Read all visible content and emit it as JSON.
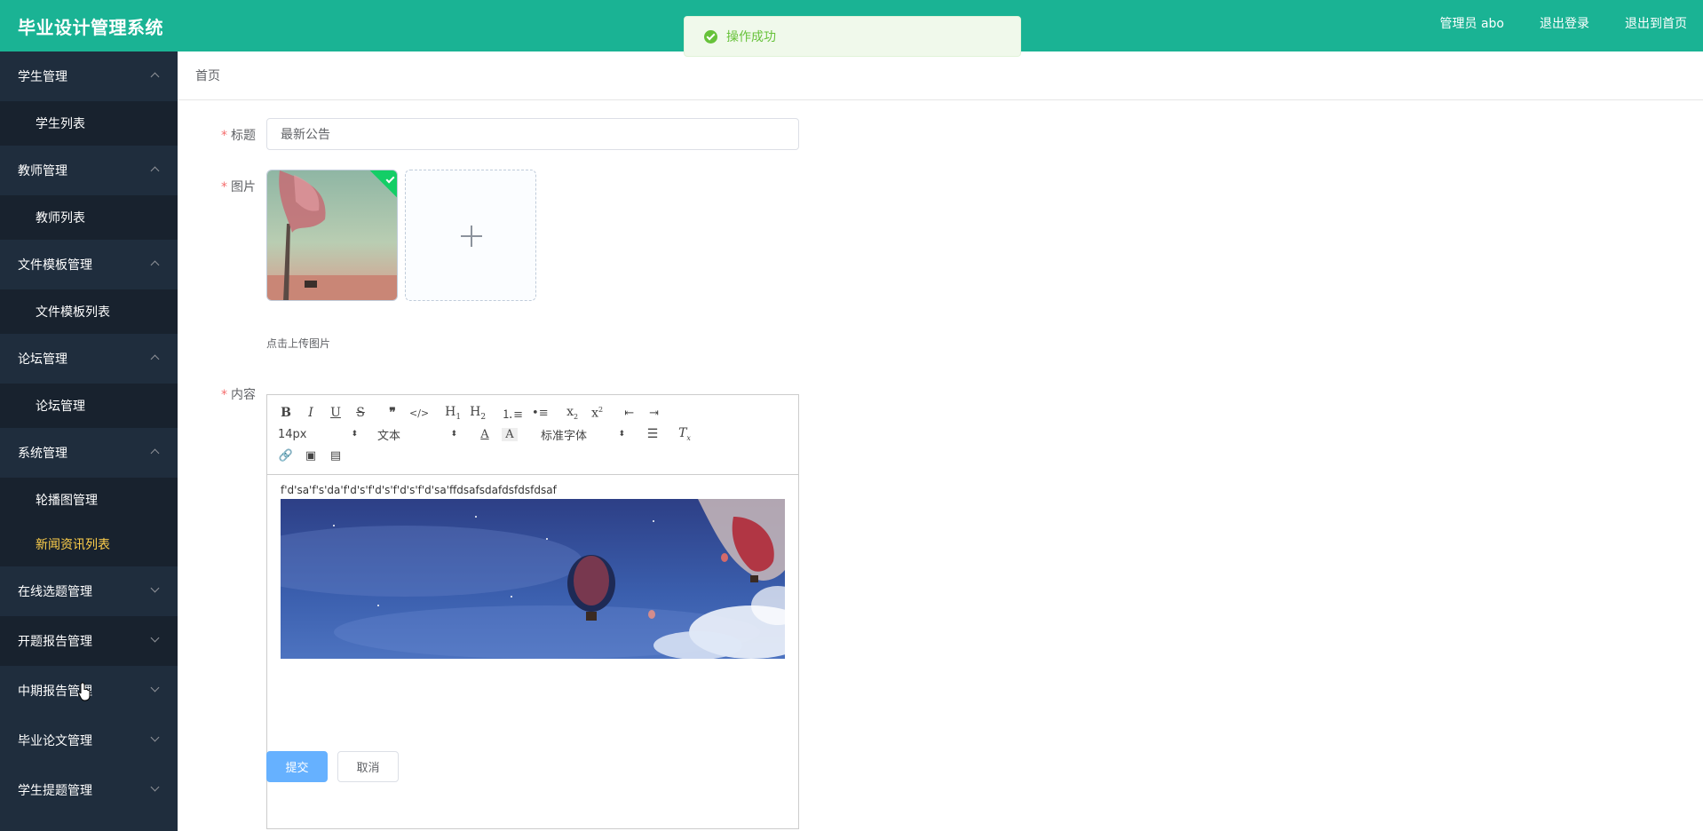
{
  "header": {
    "brand": "毕业设计管理系统",
    "admin_label": "管理员 abo",
    "logout": "退出登录",
    "exit_home": "退出到首页",
    "bg_color": "#1ab394"
  },
  "toast": {
    "message": "操作成功",
    "icon": "success-check-icon"
  },
  "sidebar": {
    "groups": [
      {
        "label": "学生管理",
        "items": [
          "学生列表"
        ]
      },
      {
        "label": "教师管理",
        "items": [
          "教师列表"
        ]
      },
      {
        "label": "文件模板管理",
        "items": [
          "文件模板列表"
        ]
      },
      {
        "label": "论坛管理",
        "items": [
          "论坛管理"
        ]
      },
      {
        "label": "系统管理",
        "items": [
          "轮播图管理",
          "新闻资讯列表"
        ]
      },
      {
        "label": "在线选题管理"
      },
      {
        "label": "开题报告管理"
      },
      {
        "label": "中期报告管理"
      },
      {
        "label": "毕业论文管理"
      },
      {
        "label": "学生提题管理"
      }
    ],
    "active_item": "新闻资讯列表",
    "active_color": "#ffd04b"
  },
  "breadcrumb": {
    "home": "首页"
  },
  "form": {
    "title_label": "标题",
    "title_value": "最新公告",
    "image_label": "图片",
    "upload_tip": "点击上传图片",
    "content_label": "内容",
    "editor": {
      "font_size": "14px",
      "header_select": "文本",
      "font_select": "标准字体",
      "content_text": "f'd'sa'f's'da'f'd's'f'd's'f'd's'f'd'sa'ffdsafsdafdsfdsfdsaf"
    },
    "submit": "提交",
    "cancel": "取消"
  }
}
